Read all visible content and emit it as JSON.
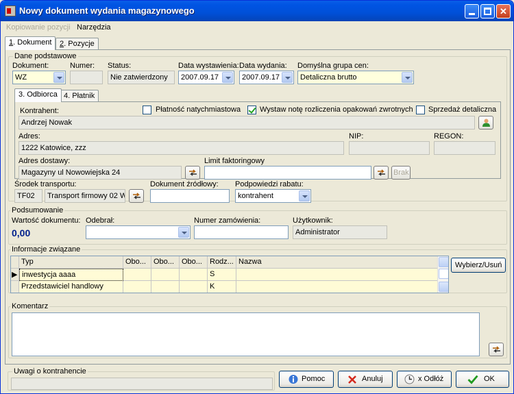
{
  "window": {
    "title": "Nowy dokument wydania magazynowego"
  },
  "menu": {
    "copy": "Kopiowanie pozycji",
    "tools": "Narzędzia"
  },
  "tabs": {
    "document": "Dokument",
    "document_key": "1",
    "positions": "Pozycje",
    "positions_key": "2"
  },
  "basic": {
    "group": "Dane podstawowe",
    "document_label": "Dokument:",
    "document_value": "WZ",
    "number_label": "Numer:",
    "number_value": "",
    "status_label": "Status:",
    "status_value": "Nie zatwierdzony",
    "issue_date_label": "Data wystawienia:",
    "issue_date_value": "2007.09.17",
    "release_date_label": "Data wydania:",
    "release_date_value": "2007.09.17",
    "price_group_label": "Domyślna grupa cen:",
    "price_group_value": "Detaliczna brutto"
  },
  "subtabs": {
    "recipient": "3. Odbiorca",
    "payer": "4. Płatnik"
  },
  "recipient": {
    "contractor_label": "Kontrahent:",
    "contractor_value": "Andrzej Nowak",
    "instant_payment": "Płatność natychmiastowa",
    "packaging_note": "Wystaw notę rozliczenia opakowań zwrotnych",
    "retail_sale": "Sprzedaż detaliczna",
    "address_label": "Adres:",
    "address_value": "1222 Katowice, zzz",
    "nip_label": "NIP:",
    "nip_value": "",
    "regon_label": "REGON:",
    "regon_value": "",
    "delivery_label": "Adres dostawy:",
    "delivery_value": "Magazyny ul Nowowiejska 24",
    "factoring_label": "Limit faktoringowy",
    "factoring_value": "",
    "brak": "Brak"
  },
  "transport": {
    "label": "Środek transportu:",
    "code": "TF02",
    "name": "Transport firmowy 02 W",
    "source_doc_label": "Dokument źródłowy:",
    "source_doc_value": "",
    "discount_label": "Podpowiedzi rabatu:",
    "discount_value": "kontrahent"
  },
  "summary": {
    "group": "Podsumowanie",
    "value_label": "Wartość dokumentu:",
    "value": "0,00",
    "receiver_label": "Odebrał:",
    "receiver_value": "",
    "order_label": "Numer zamówienia:",
    "order_value": "",
    "user_label": "Użytkownik:",
    "user_value": "Administrator"
  },
  "related": {
    "group": "Informacje związane",
    "columns": [
      "Typ",
      "Obo...",
      "Obo...",
      "Obo...",
      "Rodz...",
      "Nazwa"
    ],
    "rows": [
      [
        "inwestycja aaaa",
        "",
        "",
        "",
        "S",
        ""
      ],
      [
        "Przedstawiciel handlowy",
        "",
        "",
        "",
        "K",
        ""
      ]
    ],
    "select_button": "Wybierz/Usuń"
  },
  "comment": {
    "group": "Komentarz",
    "value": ""
  },
  "footer": {
    "notes_label": "Uwagi o kontrahencie",
    "help": "Pomoc",
    "cancel": "Anuluj",
    "postpone": "x Odłóż",
    "ok": "OK"
  },
  "colors": {
    "title_bar": "#0054e3",
    "total_value": "#00208c",
    "row_highlight": "#fffbd6"
  }
}
